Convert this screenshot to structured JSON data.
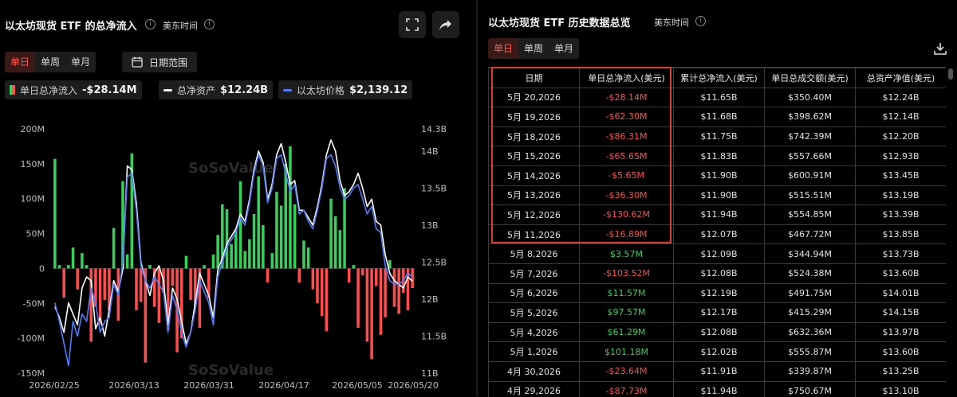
{
  "left": {
    "title": "以太坊现货 ETF 的总净流入",
    "timezone": "美东时间",
    "tabs": [
      "单日",
      "单周",
      "单月"
    ],
    "range_button": "日期范围",
    "legend": {
      "inflow": {
        "label": "单日总净流入",
        "value": "-$28.14M"
      },
      "assets": {
        "label": "总净资产",
        "value": "$12.24B"
      },
      "price": {
        "label": "以太坊价格",
        "value": "$2,139.12"
      }
    },
    "watermark": "SoSoValue"
  },
  "right": {
    "title": "以太坊现货 ETF 历史数据总览",
    "timezone": "美东时间",
    "tabs": [
      "单日",
      "单周",
      "单月"
    ],
    "table": {
      "headers": [
        "日期",
        "单日总净流入(美元)",
        "累计总净流入(美元)",
        "单日总成交额(美元)",
        "总资产净值(美元)"
      ],
      "rows": [
        [
          "5月 20,2026",
          "-$28.14M",
          "$11.65B",
          "$350.40M",
          "$12.24B"
        ],
        [
          "5月 19,2026",
          "-$62.30M",
          "$11.68B",
          "$398.62M",
          "$12.14B"
        ],
        [
          "5月 18,2026",
          "-$86.31M",
          "$11.75B",
          "$742.39M",
          "$12.20B"
        ],
        [
          "5月 15,2026",
          "-$65.65M",
          "$11.83B",
          "$557.66M",
          "$12.93B"
        ],
        [
          "5月 14,2026",
          "-$5.65M",
          "$11.90B",
          "$600.91M",
          "$13.45B"
        ],
        [
          "5月 13,2026",
          "-$36.30M",
          "$11.90B",
          "$515.51M",
          "$13.19B"
        ],
        [
          "5月 12,2026",
          "-$130.62M",
          "$11.94B",
          "$554.85M",
          "$13.39B"
        ],
        [
          "5月 11,2026",
          "-$16.89M",
          "$12.07B",
          "$467.72M",
          "$13.85B"
        ],
        [
          "5月 8,2026",
          "$3.57M",
          "$12.09B",
          "$344.94M",
          "$13.73B"
        ],
        [
          "5月 7,2026",
          "-$103.52M",
          "$12.08B",
          "$524.38M",
          "$13.60B"
        ],
        [
          "5月 6,2026",
          "$11.57M",
          "$12.19B",
          "$491.75M",
          "$14.01B"
        ],
        [
          "5月 5,2026",
          "$97.57M",
          "$12.17B",
          "$415.29M",
          "$14.15B"
        ],
        [
          "5月 4,2026",
          "$61.29M",
          "$12.08B",
          "$632.36M",
          "$13.97B"
        ],
        [
          "5月 1,2026",
          "$101.18M",
          "$12.02B",
          "$555.87M",
          "$13.60B"
        ],
        [
          "4月 30,2026",
          "-$23.64M",
          "$11.91B",
          "$339.87M",
          "$13.25B"
        ],
        [
          "4月 29,2026",
          "-$87.73M",
          "$11.94B",
          "$750.67M",
          "$13.10B"
        ]
      ]
    }
  },
  "colors": {
    "positive": "#37d05a",
    "negative": "#ff4d4d",
    "assets_line": "#ffffff",
    "price_line": "#4f7cff",
    "active_tab": "#ff5a4e",
    "highlight": "#e03a2e"
  },
  "chart_data": {
    "type": "bar",
    "title": "以太坊现货 ETF 的总净流入",
    "x_ticks": [
      "2026/02/25",
      "2026/03/13",
      "2026/03/31",
      "2026/04/17",
      "2026/05/05",
      "2026/05/20"
    ],
    "y_left": {
      "ticks": [
        "200M",
        "150M",
        "100M",
        "50M",
        "0",
        "-50M",
        "-100M",
        "-150M"
      ],
      "range": [
        -150,
        200
      ],
      "unit": "M"
    },
    "y_right": {
      "ticks": [
        "14.3B",
        "14B",
        "13.5B",
        "13B",
        "12.5B",
        "12B",
        "11.5B",
        "11B"
      ],
      "range": [
        11,
        14.3
      ],
      "unit": "B"
    },
    "series": [
      {
        "name": "单日总净流入",
        "type": "bar",
        "values": [
          157,
          5,
          -42,
          5,
          30,
          -30,
          22,
          5,
          -105,
          -55,
          -80,
          -45,
          -60,
          58,
          -75,
          125,
          20,
          165,
          -60,
          -48,
          -135,
          5,
          -55,
          -78,
          -35,
          -88,
          -25,
          -120,
          -100,
          18,
          -45,
          -55,
          -85,
          5,
          -42,
          20,
          48,
          92,
          85,
          35,
          55,
          125,
          25,
          42,
          78,
          132,
          62,
          -20,
          22,
          110,
          90,
          150,
          175,
          92,
          -20,
          40,
          30,
          -30,
          -50,
          -68,
          -90,
          100,
          75,
          55,
          115,
          -20,
          5,
          -85,
          -10,
          -105,
          -130,
          -25,
          -95,
          -70,
          12,
          -55,
          -65,
          -35,
          -60,
          -28
        ]
      },
      {
        "name": "总净资产",
        "type": "line",
        "values": [
          11.9,
          11.75,
          11.55,
          11.95,
          11.8,
          11.65,
          12.15,
          12.3,
          12.25,
          11.6,
          11.75,
          11.5,
          11.85,
          12.25,
          12.1,
          12.4,
          13.8,
          13.75,
          13.3,
          12.5,
          12.25,
          12.05,
          12.35,
          12.45,
          12.25,
          11.65,
          12.15,
          12.0,
          11.7,
          11.4,
          11.55,
          11.95,
          12.35,
          12.2,
          12.05,
          11.75,
          12.4,
          12.55,
          12.75,
          12.85,
          12.95,
          13.15,
          13.05,
          13.35,
          13.75,
          14.0,
          13.85,
          13.35,
          13.55,
          13.95,
          14.1,
          13.85,
          13.55,
          13.6,
          13.2,
          13.2,
          13.1,
          13.0,
          13.25,
          13.55,
          13.95,
          14.15,
          14.0,
          13.6,
          13.4,
          13.45,
          13.55,
          13.7,
          13.5,
          13.25,
          13.35,
          13.05,
          13.0,
          12.6,
          12.35,
          12.25,
          12.2,
          12.15,
          12.3,
          12.24
        ]
      },
      {
        "name": "以太坊价格",
        "type": "line",
        "values": [
          11.95,
          11.7,
          11.4,
          11.1,
          11.7,
          11.5,
          11.8,
          11.7,
          12.15,
          11.95,
          11.55,
          11.7,
          11.75,
          12.2,
          12.05,
          12.5,
          13.65,
          13.7,
          13.2,
          12.45,
          12.25,
          12.15,
          12.3,
          12.2,
          12.1,
          11.55,
          12.05,
          11.85,
          11.55,
          11.35,
          11.55,
          11.85,
          12.25,
          12.1,
          11.95,
          11.65,
          12.3,
          12.5,
          12.7,
          12.8,
          12.9,
          13.1,
          13.0,
          13.3,
          13.7,
          13.95,
          13.8,
          13.3,
          13.5,
          13.9,
          13.95,
          13.7,
          13.45,
          13.55,
          13.15,
          13.2,
          13.05,
          12.95,
          13.2,
          13.5,
          13.9,
          13.95,
          13.8,
          13.5,
          13.35,
          13.4,
          13.5,
          13.55,
          13.35,
          13.15,
          13.25,
          12.95,
          12.9,
          12.45,
          12.25,
          12.2,
          12.2,
          12.25,
          12.35,
          12.3
        ]
      }
    ]
  }
}
